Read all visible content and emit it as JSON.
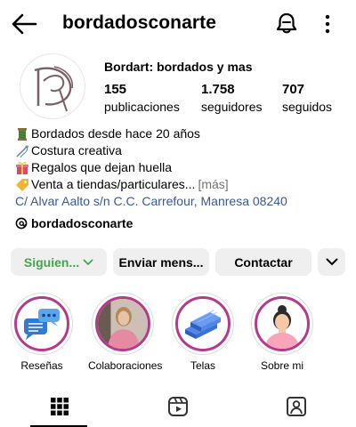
{
  "header": {
    "username": "bordadosconarte",
    "icons": [
      "back-arrow-icon",
      "notification-bell-icon",
      "more-options-icon"
    ]
  },
  "profile": {
    "display_name": "Bordart: bordados y mas",
    "stats": [
      {
        "value": "155",
        "label": "publicaciones"
      },
      {
        "value": "1.758",
        "label": "seguidores"
      },
      {
        "value": "707",
        "label": "seguidos"
      }
    ],
    "bio": [
      {
        "emoji": "thread-spool-icon",
        "text": "Bordados desde hace 20 años"
      },
      {
        "emoji": "sewing-needle-icon",
        "text": "Costura creativa"
      },
      {
        "emoji": "gift-icon",
        "text": "Regalos que dejan huella"
      },
      {
        "emoji": "price-tag-icon",
        "text": "Venta a tiendas/particulares...",
        "more": "[más]"
      }
    ],
    "address": "C/ Alvar Aalto s/n C.C. Carrefour, Manresa 08240",
    "threads_handle": "bordadosconarte"
  },
  "actions": {
    "follow": "Siguien...",
    "message": "Enviar mens...",
    "contact": "Contactar"
  },
  "highlights": [
    {
      "label": "Reseñas"
    },
    {
      "label": "Colaboraciones"
    },
    {
      "label": "Telas"
    },
    {
      "label": "Sobre mi"
    }
  ],
  "colors": {
    "following_green": "#3ea84a",
    "highlight_ring": "#b43a8c",
    "link_blue": "#385898"
  }
}
